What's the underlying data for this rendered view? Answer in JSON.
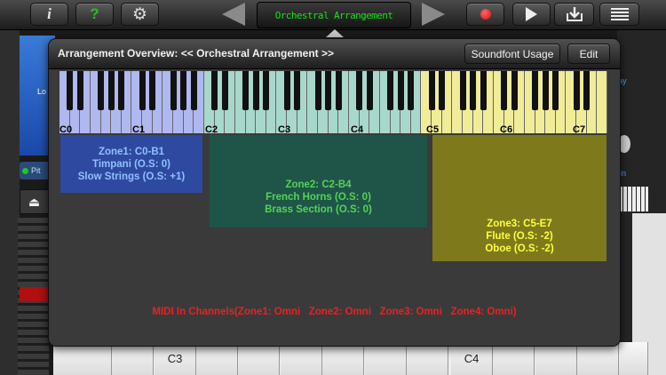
{
  "toolbar": {
    "title": "Orchestral Arrangement",
    "icons": [
      "info-icon",
      "help-icon",
      "gear-icon",
      "prev-arrow-icon",
      "next-arrow-icon",
      "record-icon",
      "play-icon",
      "download-icon",
      "menu-list-icon"
    ],
    "info_glyph": "i",
    "help_glyph": "?",
    "gear_glyph": "⚙",
    "list_glyph": "≡"
  },
  "background": {
    "left_tab_label": "Lo",
    "pit_label": "Pit",
    "right_label_1": "lay",
    "right_label_2": "in",
    "piano_labels": [
      "C3",
      "C4"
    ]
  },
  "panel": {
    "title": "Arrangement Overview: << Orchestral Arrangement >>",
    "soundfont_button": "Soundfont Usage",
    "edit_button": "Edit",
    "octave_labels": [
      "C0",
      "C1",
      "C2",
      "C3",
      "C4",
      "C5",
      "C6",
      "C7"
    ],
    "keyboard_colors": {
      "zone1": "#b0b8f0",
      "zone2": "#a8d8cc",
      "zone3": "#f0ec98"
    },
    "zones": [
      {
        "lines": [
          "Zone1: C0-B1",
          "Timpani (O.S: 0)",
          "Slow Strings (O.S: +1)"
        ],
        "color": "#2e4aa0"
      },
      {
        "lines": [
          "Zone2: C2-B4",
          "French Horns (O.S: 0)",
          "Brass Section (O.S: 0)"
        ],
        "color": "#1e5548"
      },
      {
        "lines": [
          "Zone3: C5-E7",
          "Flute (O.S: -2)",
          "Oboe (O.S: -2)"
        ],
        "color": "#7e7a1c"
      }
    ],
    "midi_channels": "MIDI In Channels(Zone1: Omni   Zone2: Omni   Zone3: Omni   Zone4: Omni)"
  }
}
